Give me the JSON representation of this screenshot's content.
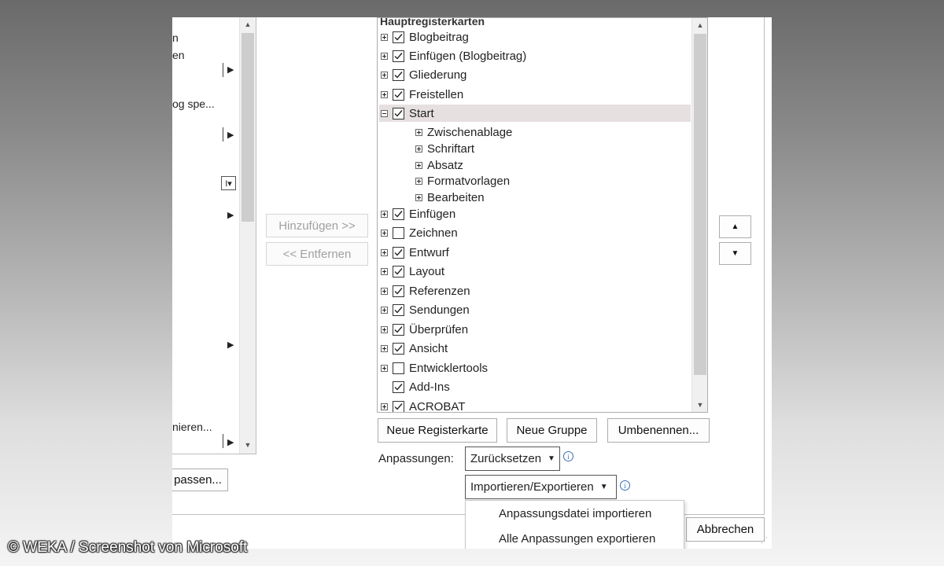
{
  "left_panel": {
    "items": [
      {
        "label": "n"
      },
      {
        "label": "en"
      },
      {
        "label": "og spe..."
      },
      {
        "label": "nieren..."
      }
    ],
    "bottom_button_label": "passen..."
  },
  "middle": {
    "add_button": "Hinzufügen >>",
    "remove_button": "<< Entfernen"
  },
  "tree": {
    "header": "Hauptregisterkarten",
    "rows": [
      {
        "label": "Blogbeitrag",
        "checked": true,
        "expander": "plus",
        "level": 0
      },
      {
        "label": "Einfügen (Blogbeitrag)",
        "checked": true,
        "expander": "plus",
        "level": 0
      },
      {
        "label": "Gliederung",
        "checked": true,
        "expander": "plus",
        "level": 0
      },
      {
        "label": "Freistellen",
        "checked": true,
        "expander": "plus",
        "level": 0
      },
      {
        "label": "Start",
        "checked": true,
        "expander": "minus",
        "level": 0,
        "selected": true
      },
      {
        "label": "Zwischenablage",
        "expander": "plus",
        "level": 1
      },
      {
        "label": "Schriftart",
        "expander": "plus",
        "level": 1
      },
      {
        "label": "Absatz",
        "expander": "plus",
        "level": 1
      },
      {
        "label": "Formatvorlagen",
        "expander": "plus",
        "level": 1
      },
      {
        "label": "Bearbeiten",
        "expander": "plus",
        "level": 1
      },
      {
        "label": "Einfügen",
        "checked": true,
        "expander": "plus",
        "level": 0
      },
      {
        "label": "Zeichnen",
        "checked": false,
        "expander": "plus",
        "level": 0
      },
      {
        "label": "Entwurf",
        "checked": true,
        "expander": "plus",
        "level": 0
      },
      {
        "label": "Layout",
        "checked": true,
        "expander": "plus",
        "level": 0
      },
      {
        "label": "Referenzen",
        "checked": true,
        "expander": "plus",
        "level": 0
      },
      {
        "label": "Sendungen",
        "checked": true,
        "expander": "plus",
        "level": 0
      },
      {
        "label": "Überprüfen",
        "checked": true,
        "expander": "plus",
        "level": 0
      },
      {
        "label": "Ansicht",
        "checked": true,
        "expander": "plus",
        "level": 0
      },
      {
        "label": "Entwicklertools",
        "checked": false,
        "expander": "plus",
        "level": 0
      },
      {
        "label": "Add-Ins",
        "checked": true,
        "expander": "none",
        "level": 0
      },
      {
        "label": "ACROBAT",
        "checked": true,
        "expander": "plus",
        "level": 0
      }
    ]
  },
  "buttons": {
    "new_tab": "Neue Registerkarte",
    "new_group": "Neue Gruppe",
    "rename": "Umbenennen..."
  },
  "customizations": {
    "label": "Anpassungen:",
    "reset": "Zurücksetzen",
    "import_export": "Importieren/Exportieren"
  },
  "dropdown_menu": {
    "items": [
      "Anpassungsdatei importieren",
      "Alle Anpassungen exportieren"
    ]
  },
  "cancel_button": "Abbrechen",
  "watermark": "© WEKA / Screenshot von Microsoft",
  "info_glyph": "i"
}
